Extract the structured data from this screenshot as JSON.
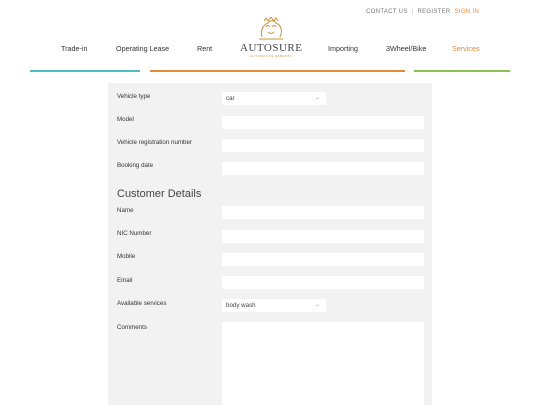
{
  "top_links": {
    "contact": "CONTACT US",
    "separator": "|",
    "register": "REGISTER",
    "signin": "SIGN IN"
  },
  "nav": {
    "items": [
      {
        "label": "Trade-in"
      },
      {
        "label": "Operating Lease"
      },
      {
        "label": "Rent"
      },
      {
        "label": "Importing"
      },
      {
        "label": "3Wheel/Bike"
      },
      {
        "label": "Services"
      }
    ],
    "active": "Services"
  },
  "logo": {
    "name": "AUTOSURE",
    "tagline": "AUTOMOTIVE EXPERTS",
    "icon": "lion-crest-icon"
  },
  "colors": {
    "accent_orange": "#e58a3a",
    "teal": "#4fbdbd",
    "green": "#8bc34a",
    "panel_bg": "#f2f2f2"
  },
  "form": {
    "vehicle_type": {
      "label": "Vehicle type",
      "value": "car"
    },
    "model": {
      "label": "Model",
      "value": ""
    },
    "registration": {
      "label": "Vehicle registration number",
      "value": ""
    },
    "booking_date": {
      "label": "Booking date",
      "value": ""
    },
    "customer_section_title": "Customer Details",
    "name": {
      "label": "Name",
      "value": ""
    },
    "nic": {
      "label": "NIC Number",
      "value": ""
    },
    "mobile": {
      "label": "Mobile",
      "value": ""
    },
    "email": {
      "label": "Email",
      "value": ""
    },
    "services": {
      "label": "Available services",
      "value": "body wash"
    },
    "comments": {
      "label": "Comments",
      "value": ""
    }
  }
}
